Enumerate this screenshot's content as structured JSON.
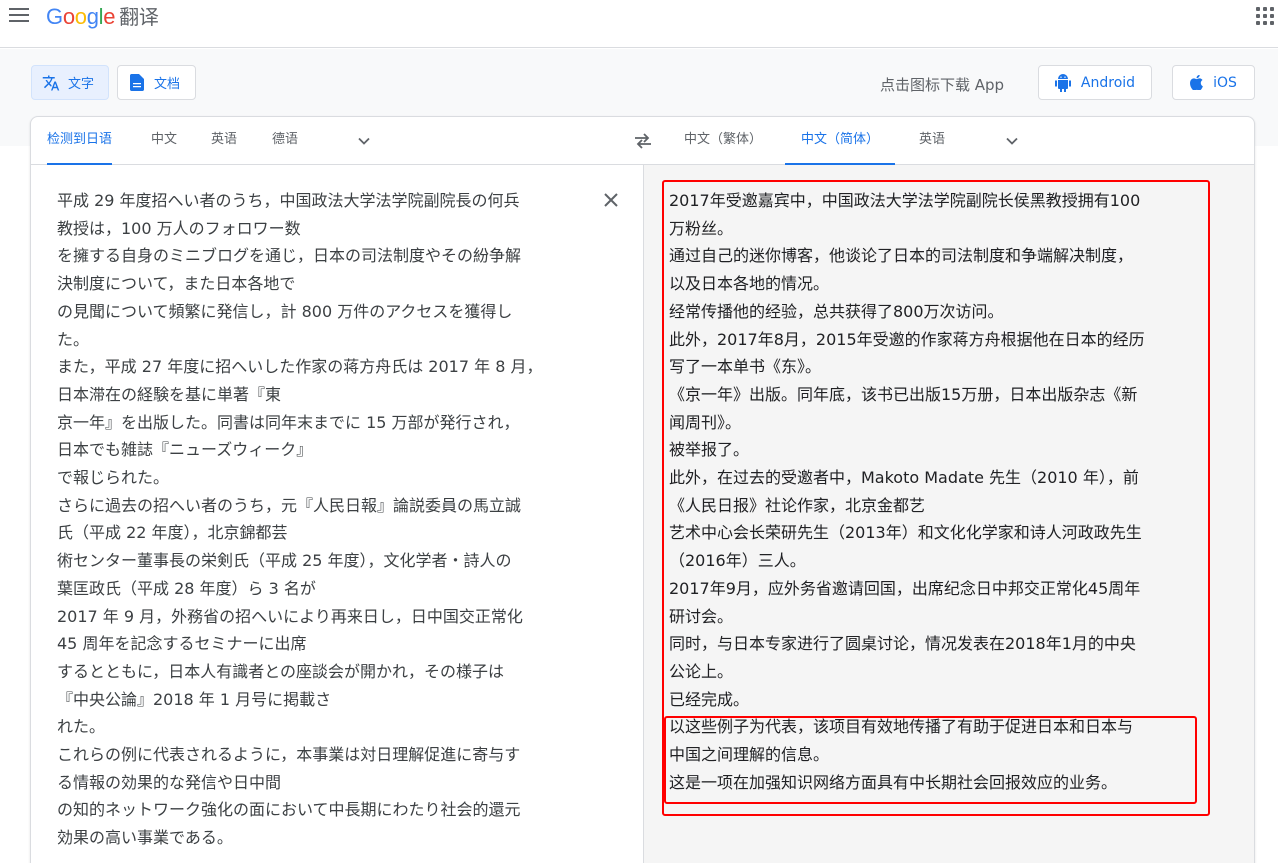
{
  "header": {
    "logo_text": "Google",
    "logo_suffix": "翻译"
  },
  "modes": {
    "text_label": "文字",
    "doc_label": "文档"
  },
  "download": {
    "prompt": "点击图标下载 App",
    "android_label": "Android",
    "ios_label": "iOS"
  },
  "source_tabs": [
    "检测到日语",
    "中文",
    "英语",
    "德语"
  ],
  "target_tabs": [
    "中文（繁体）",
    "中文（简体）",
    "英语"
  ],
  "source_lines": [
    "平成 29 年度招へい者のうち，中国政法大学法学院副院長の何兵",
    "教授は，100 万人のフォロワー数",
    "を擁する自身のミニブログを通じ，日本の司法制度やその紛争解",
    "決制度について，また日本各地で",
    "の見聞について頻繁に発信し，計 800 万件のアクセスを獲得し",
    "た。",
    "また，平成 27 年度に招へいした作家の蒋方舟氏は 2017 年 8 月，",
    "日本滞在の経験を基に単著『東",
    "京一年』を出版した。同書は同年末までに 15 万部が発行され，",
    "日本でも雑誌『ニューズウィーク』",
    "で報じられた。",
    "さらに過去の招へい者のうち，元『人民日報』論説委員の馬立誠",
    "氏（平成 22 年度），北京錦都芸",
    "術センター董事長の栄剣氏（平成 25 年度），文化学者・詩人の",
    "葉匡政氏（平成 28 年度）ら 3 名が",
    "2017 年 9 月，外務省の招へいにより再来日し，日中国交正常化",
    "45 周年を記念するセミナーに出席",
    "するとともに，日本人有識者との座談会が開かれ，その様子は",
    "『中央公論』2018 年 1 月号に掲載さ",
    "れた。",
    "これらの例に代表されるように，本事業は対日理解促進に寄与す",
    "る情報の効果的な発信や日中間",
    "の知的ネットワーク強化の面において中長期にわたり社会的還元",
    "効果の高い事業である。"
  ],
  "target_lines": [
    "2017年受邀嘉宾中，中国政法大学法学院副院长侯黑教授拥有100",
    "万粉丝。",
    "通过自己的迷你博客，他谈论了日本的司法制度和争端解决制度，",
    "以及日本各地的情况。",
    "经常传播他的经验，总共获得了800万次访问。",
    "此外，2017年8月，2015年受邀的作家蒋方舟根据他在日本的经历",
    "写了一本单书《东》。",
    "《京一年》出版。同年底，该书已出版15万册，日本出版杂志《新",
    "闻周刊》。",
    "被举报了。",
    "此外，在过去的受邀者中，Makoto Madate 先生（2010 年），前",
    "《人民日报》社论作家，北京金都艺",
    "艺术中心会长荣研先生（2013年）和文化化学家和诗人河政政先生",
    "（2016年）三人。",
    "2017年9月，应外务省邀请回国，出席纪念日中邦交正常化45周年",
    "研讨会。",
    "同时，与日本专家进行了圆桌讨论，情况发表在2018年1月的中央",
    "公论上。",
    "已经完成。",
    "以这些例子为代表，该项目有效地传播了有助于促进日本和日本与",
    "中国之间理解的信息。",
    "这是一项在加强知识网络方面具有中长期社会回报效应的业务。"
  ],
  "colors": {
    "accent": "#1a73e8",
    "highlight": "#ff0000"
  }
}
